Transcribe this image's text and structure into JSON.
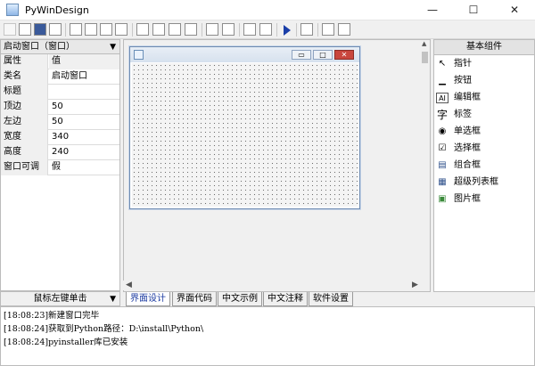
{
  "window": {
    "title": "PyWinDesign",
    "min_glyph": "—",
    "max_glyph": "☐",
    "close_glyph": "✕"
  },
  "left_panel": {
    "header": "启动窗口（窗口）",
    "columns": [
      "属性",
      "值"
    ],
    "rows": [
      {
        "key": "类名",
        "value": "启动窗口"
      },
      {
        "key": "标题",
        "value": ""
      },
      {
        "key": "顶边",
        "value": "50"
      },
      {
        "key": "左边",
        "value": "50"
      },
      {
        "key": "宽度",
        "value": "340"
      },
      {
        "key": "高度",
        "value": "240"
      },
      {
        "key": "窗口可调",
        "value": "假"
      }
    ],
    "status": "鼠标左键单击"
  },
  "designer": {
    "form_buttons": {
      "min": "▭",
      "max": "□",
      "close": "✕"
    }
  },
  "tabs": [
    "界面设计",
    "界面代码",
    "中文示例",
    "中文注释",
    "软件设置"
  ],
  "right_panel": {
    "header": "基本组件",
    "items": [
      {
        "label": "指针",
        "icon": "pointer-icon",
        "glyph": "↖"
      },
      {
        "label": "按钮",
        "icon": "button-icon",
        "glyph": "▁"
      },
      {
        "label": "编辑框",
        "icon": "editbox-icon",
        "glyph": "AI"
      },
      {
        "label": "标签",
        "icon": "label-icon",
        "glyph": "字"
      },
      {
        "label": "单选框",
        "icon": "radio-icon",
        "glyph": "◉"
      },
      {
        "label": "选择框",
        "icon": "checkbox-icon",
        "glyph": "☑"
      },
      {
        "label": "组合框",
        "icon": "combobox-icon",
        "glyph": "▤"
      },
      {
        "label": "超级列表框",
        "icon": "listview-icon",
        "glyph": "▦"
      },
      {
        "label": "图片框",
        "icon": "picturebox-icon",
        "glyph": "▣"
      }
    ]
  },
  "log": [
    "[18:08:23]新建窗口完毕",
    "[18:08:24]获取到Python路径：D:\\install\\Python\\",
    "[18:08:24]pyinstaller库已安装"
  ]
}
